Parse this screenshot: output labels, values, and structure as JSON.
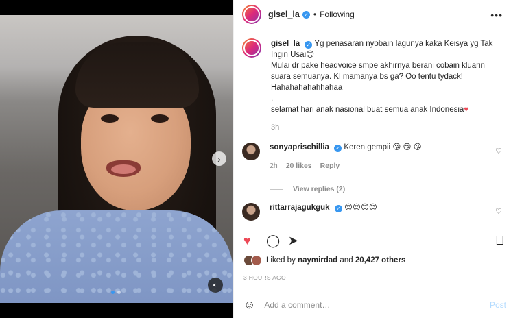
{
  "post": {
    "username": "gisel_la",
    "separator": "•",
    "follow_status": "Following",
    "more_icon": "more-horizontal-icon"
  },
  "caption": {
    "username": "gisel_la",
    "line1": "Yg penasaran nyobain lagunya kaka Keisya yg Tak Ingin Usai",
    "line1_emoji": "😍",
    "line2": "Mulai dr pake headvoice smpe akhirnya berani cobain kluarin suara semuanya. Kl mamanya bs ga? Oo tentu tydack! Hahahahahahhahaa",
    "line3": ".",
    "line4": "selamat hari anak nasional buat semua anak Indonesia",
    "line4_emoji": "♥",
    "time": "3h"
  },
  "comments": [
    {
      "username": "sonyaprischillia",
      "text": "Keren gempii",
      "emojis": "😘 😘 😘",
      "time": "2h",
      "likes": "20 likes",
      "reply": "Reply"
    },
    {
      "username": "rittarrajagukguk",
      "text": "",
      "emojis": "😍😍😍😍",
      "time": "",
      "likes": "",
      "reply": ""
    }
  ],
  "view_replies": "View replies (2)",
  "likes": {
    "prefix": "Liked by",
    "user": "naymirdad",
    "middle": "and",
    "others": "20,427 others"
  },
  "date": "3 HOURS AGO",
  "add_comment": {
    "placeholder": "Add a comment…",
    "post_label": "Post"
  },
  "media": {
    "slide_current": 1,
    "slide_total": 2
  },
  "colors": {
    "accent": "#3897f0",
    "like_red": "#ed4956",
    "muted": "#8e8e8e"
  }
}
